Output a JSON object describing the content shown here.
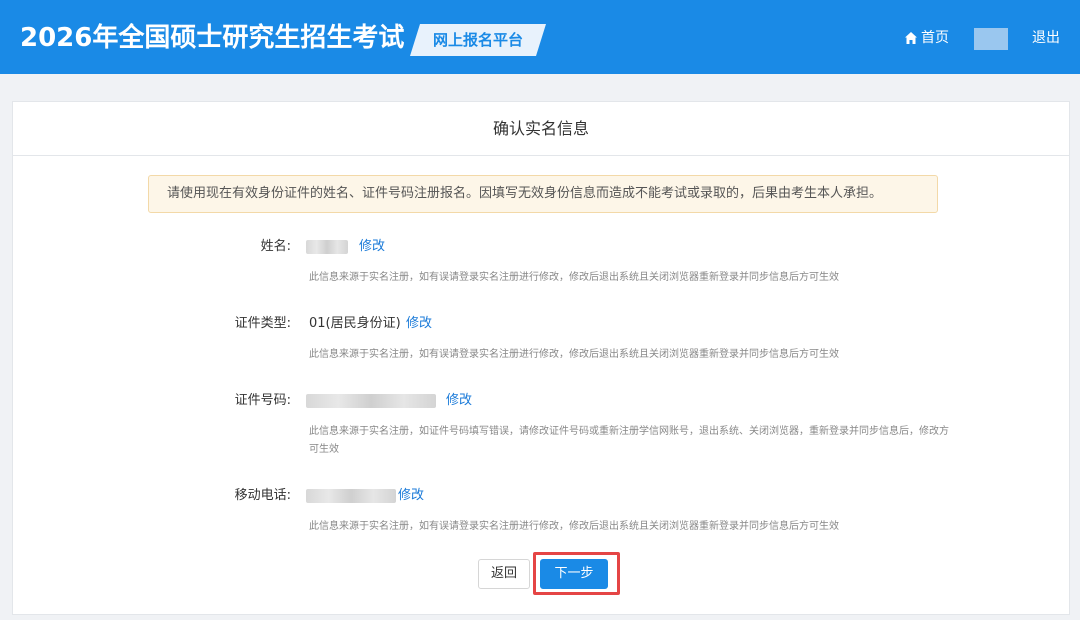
{
  "header": {
    "title": "2026年全国硕士研究生招生考试",
    "platform": "网上报名平台",
    "home_label": "首页",
    "logout_label": "退出"
  },
  "card": {
    "title": "确认实名信息",
    "notice": "请使用现在有效身份证件的姓名、证件号码注册报名。因填写无效身份信息而造成不能考试或录取的，后果由考生本人承担。"
  },
  "fields": {
    "name": {
      "label": "姓名:",
      "edit": "修改",
      "hint": "此信息来源于实名注册，如有误请登录实名注册进行修改，修改后退出系统且关闭浏览器重新登录并同步信息后方可生效"
    },
    "id_type": {
      "label": "证件类型:",
      "value": "01(居民身份证)",
      "edit": "修改",
      "hint": "此信息来源于实名注册，如有误请登录实名注册进行修改，修改后退出系统且关闭浏览器重新登录并同步信息后方可生效"
    },
    "id_number": {
      "label": "证件号码:",
      "edit": "修改",
      "hint": "此信息来源于实名注册，如证件号码填写错误，请修改证件号码或重新注册学信网账号，退出系统、关闭浏览器，重新登录并同步信息后，修改方可生效"
    },
    "phone": {
      "label": "移动电话:",
      "edit": "修改",
      "hint": "此信息来源于实名注册，如有误请登录实名注册进行修改，修改后退出系统且关闭浏览器重新登录并同步信息后方可生效"
    }
  },
  "buttons": {
    "back": "返回",
    "next": "下一步"
  },
  "colors": {
    "header_bg": "#1a8ae6",
    "link": "#1a7ad8",
    "notice_bg": "#fdf6e8",
    "highlight": "#e54545"
  },
  "icons": {
    "home": "home-icon"
  }
}
